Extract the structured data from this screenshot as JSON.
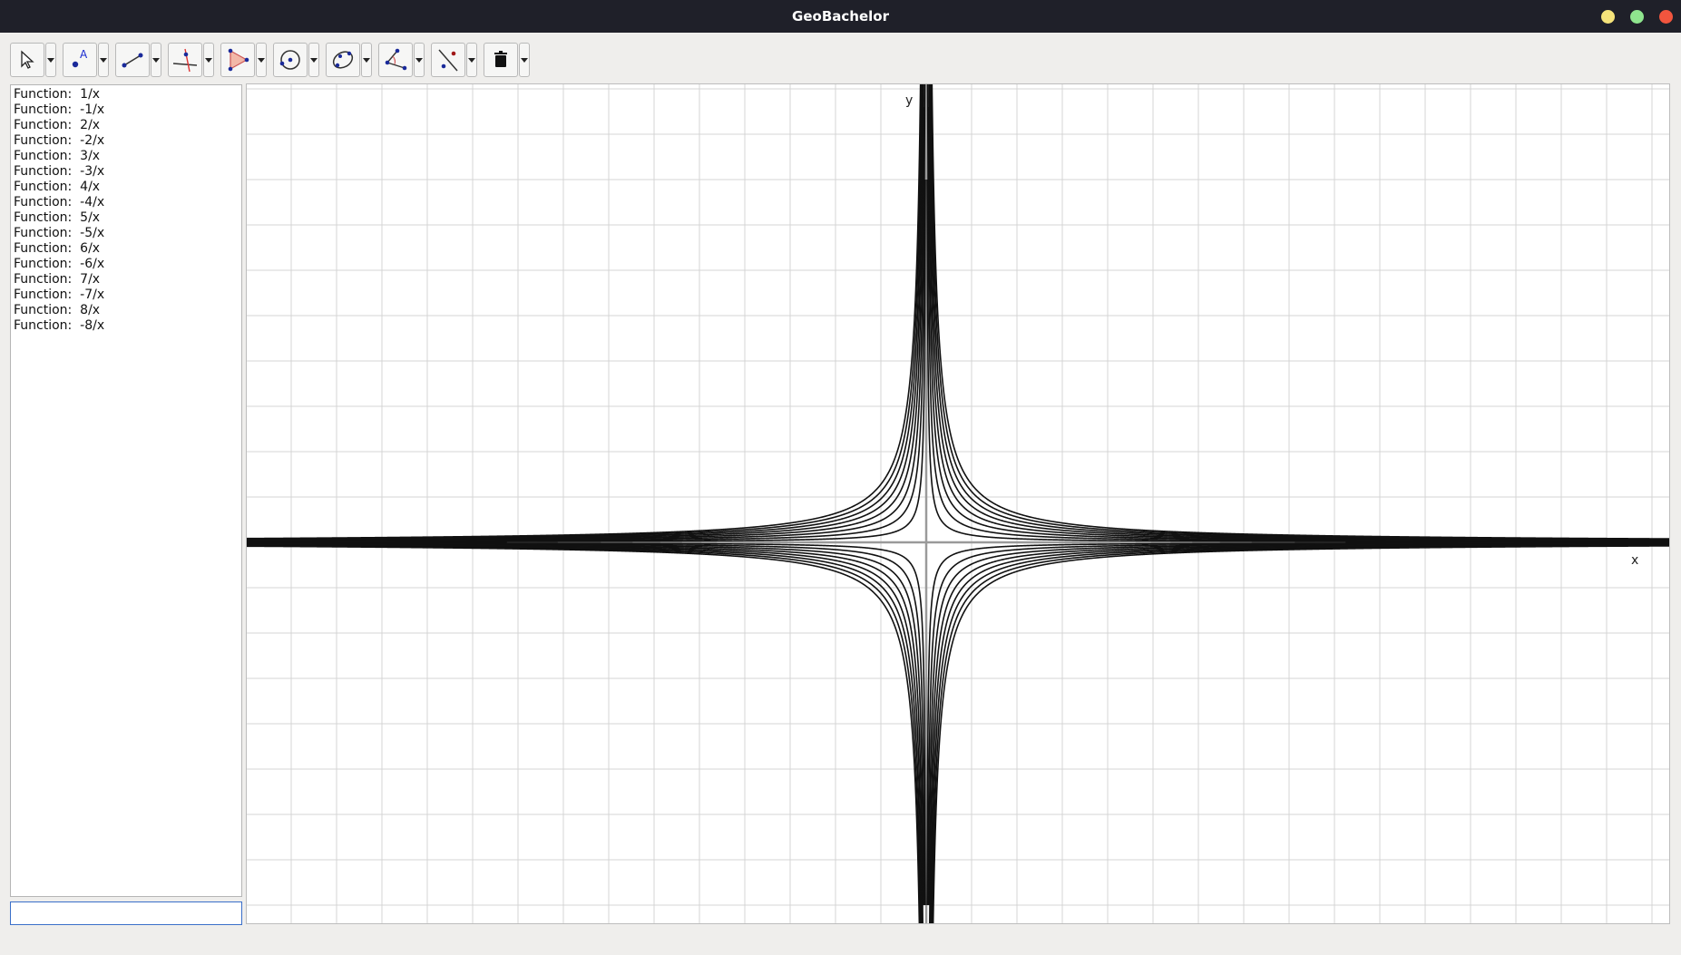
{
  "window": {
    "title": "GeoBachelor",
    "controls": {
      "minimize": "#f5e37a",
      "maximize": "#8fe58e",
      "close": "#f2553e"
    }
  },
  "toolbar": {
    "tools": [
      {
        "name": "select-tool",
        "icon": "arrow-pointer-icon"
      },
      {
        "name": "point-tool",
        "icon": "point-label-icon"
      },
      {
        "name": "segment-tool",
        "icon": "segment-icon"
      },
      {
        "name": "perpendicular-tool",
        "icon": "perpendicular-lines-icon"
      },
      {
        "name": "polygon-tool",
        "icon": "triangle-icon"
      },
      {
        "name": "circle-tool",
        "icon": "circle-center-icon"
      },
      {
        "name": "conic-tool",
        "icon": "ellipse-icon"
      },
      {
        "name": "angle-tool",
        "icon": "angle-icon"
      },
      {
        "name": "reflect-tool",
        "icon": "reflect-line-icon"
      },
      {
        "name": "delete-tool",
        "icon": "trash-icon"
      }
    ]
  },
  "algebra": {
    "items": [
      {
        "label": "Function:  1/x",
        "k": 1
      },
      {
        "label": "Function:  -1/x",
        "k": -1
      },
      {
        "label": "Function:  2/x",
        "k": 2
      },
      {
        "label": "Function:  -2/x",
        "k": -2
      },
      {
        "label": "Function:  3/x",
        "k": 3
      },
      {
        "label": "Function:  -3/x",
        "k": -3
      },
      {
        "label": "Function:  4/x",
        "k": 4
      },
      {
        "label": "Function:  -4/x",
        "k": -4
      },
      {
        "label": "Function:  5/x",
        "k": 5
      },
      {
        "label": "Function:  -5/x",
        "k": -5
      },
      {
        "label": "Function:  6/x",
        "k": 6
      },
      {
        "label": "Function:  -6/x",
        "k": -6
      },
      {
        "label": "Function:  7/x",
        "k": 7
      },
      {
        "label": "Function:  -7/x",
        "k": -7
      },
      {
        "label": "Function:  8/x",
        "k": 8
      },
      {
        "label": "Function:  -8/x",
        "k": -8
      }
    ]
  },
  "input": {
    "value": "",
    "placeholder": ""
  },
  "graph": {
    "x_axis_label": "x",
    "y_axis_label": "y",
    "curve_color": "#111111",
    "grid_color": "#d4d4d4",
    "axis_color": "#9a9a9a"
  }
}
